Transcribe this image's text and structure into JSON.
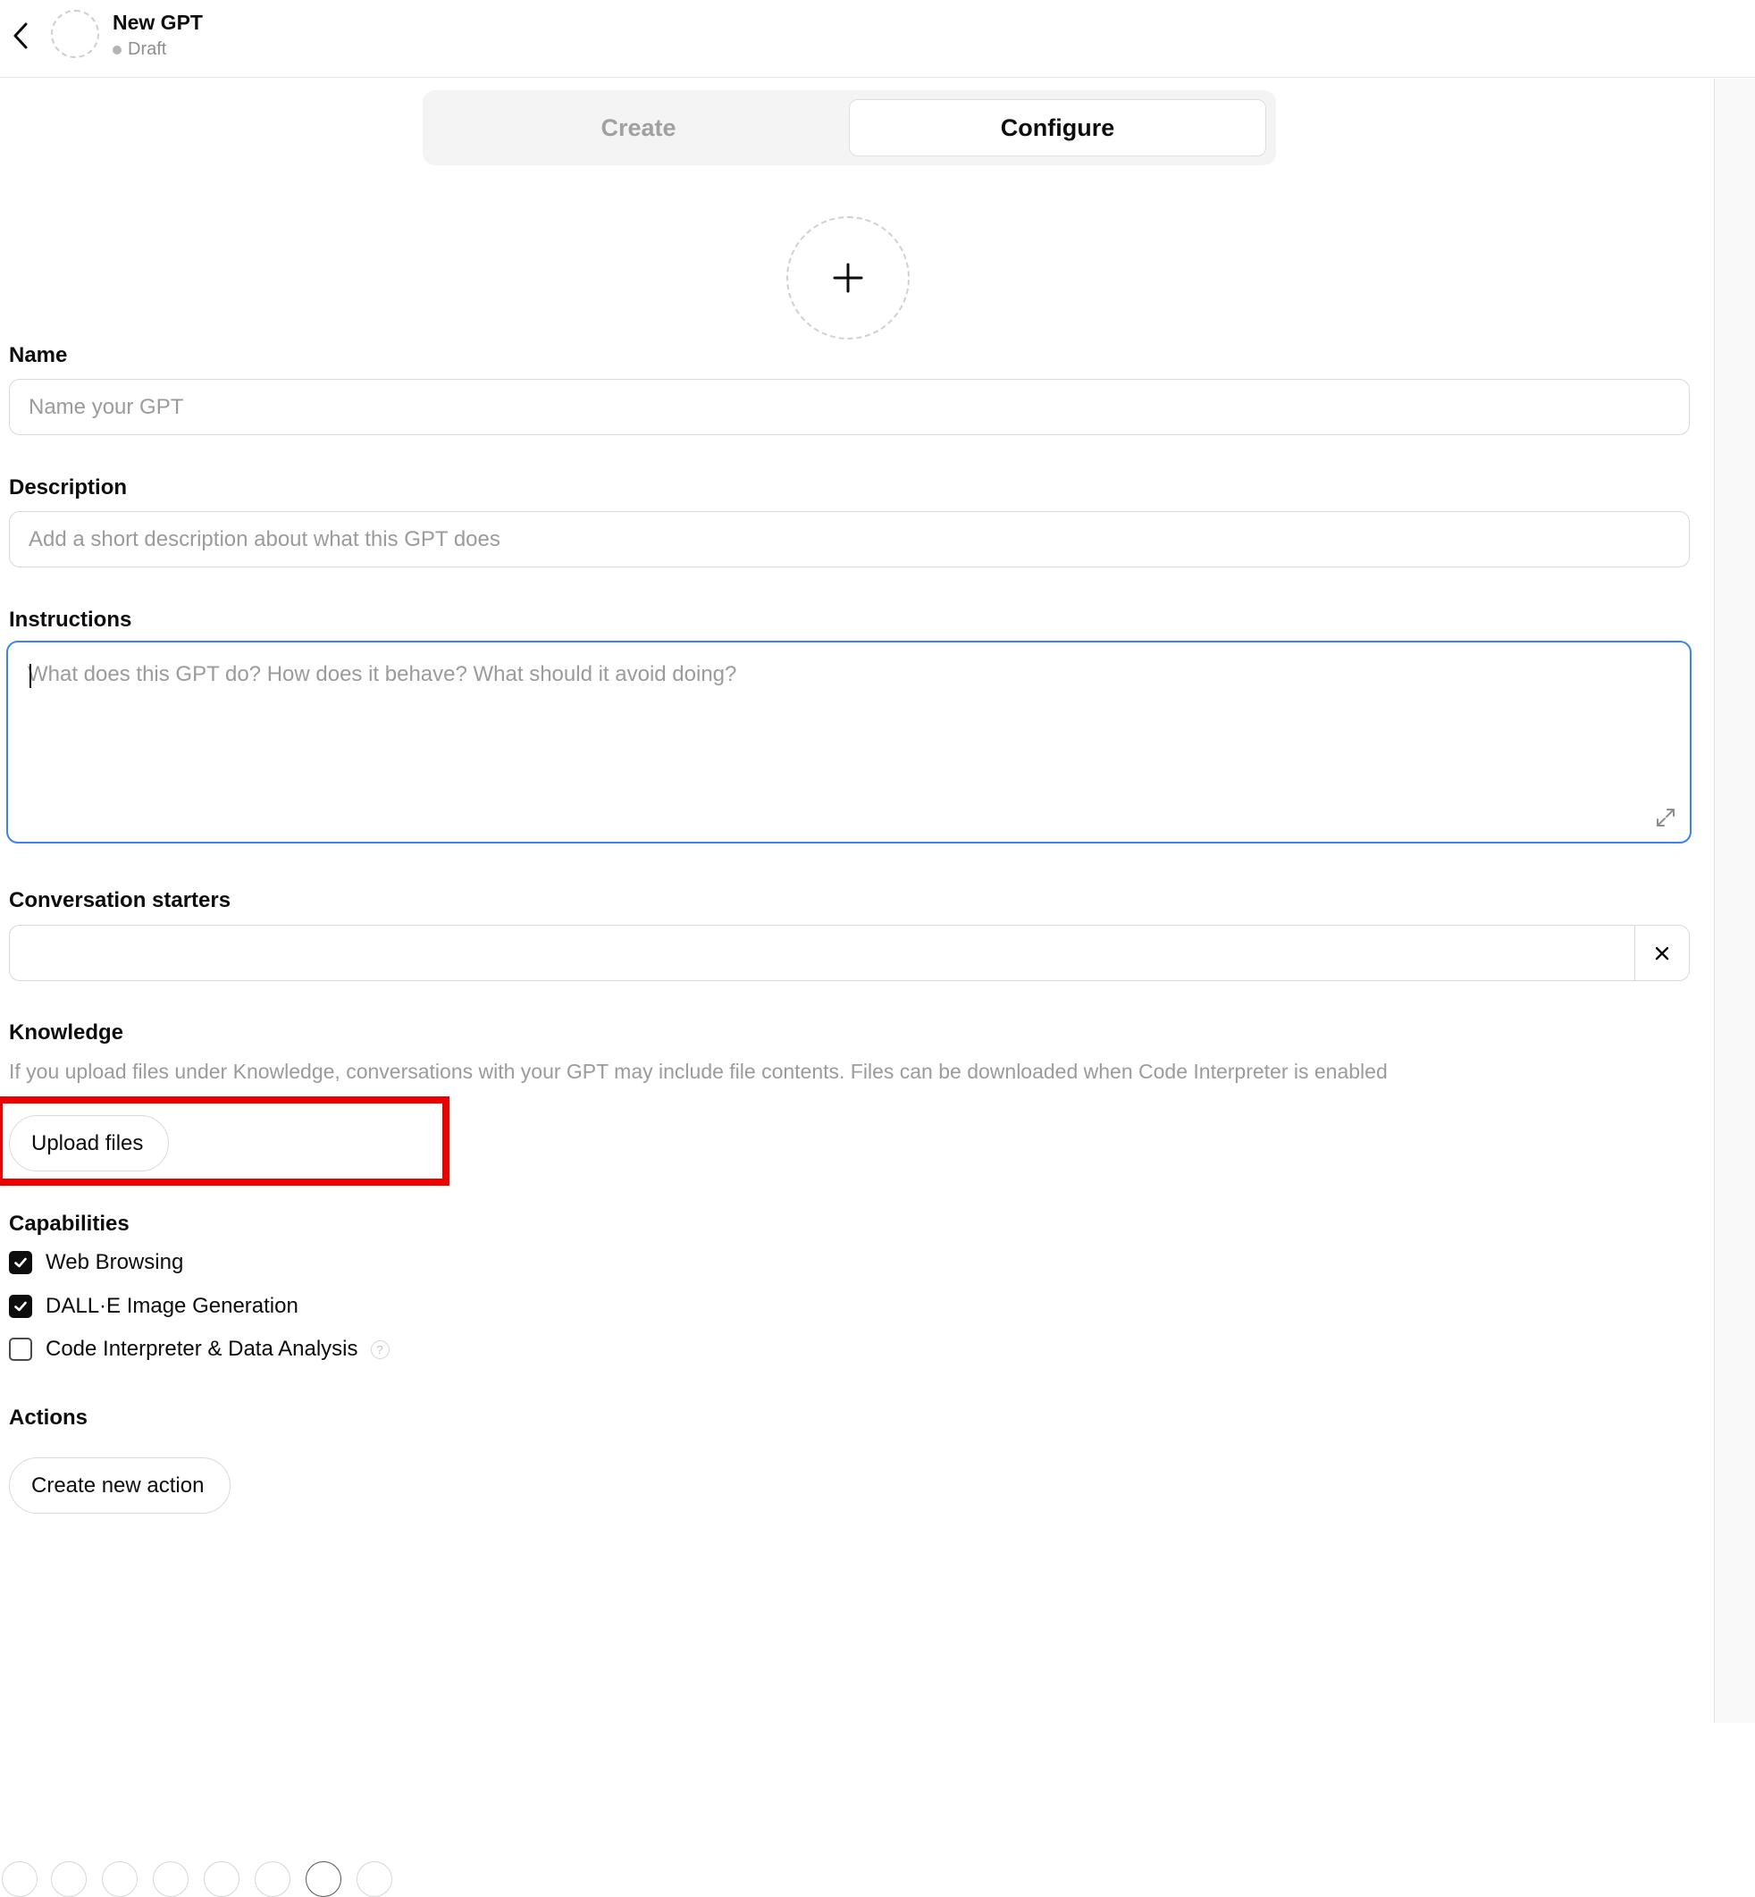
{
  "header": {
    "title": "New GPT",
    "status": "Draft"
  },
  "tabs": [
    {
      "label": "Create",
      "active": false
    },
    {
      "label": "Configure",
      "active": true
    }
  ],
  "form": {
    "name": {
      "label": "Name",
      "placeholder": "Name your GPT",
      "value": ""
    },
    "description": {
      "label": "Description",
      "placeholder": "Add a short description about what this GPT does",
      "value": ""
    },
    "instructions": {
      "label": "Instructions",
      "placeholder": "What does this GPT do? How does it behave? What should it avoid doing?",
      "value": ""
    },
    "conversation_starters": {
      "label": "Conversation starters",
      "value": ""
    }
  },
  "knowledge": {
    "label": "Knowledge",
    "note": "If you upload files under Knowledge, conversations with your GPT may include file contents. Files can be downloaded when Code Interpreter is enabled",
    "upload_label": "Upload files"
  },
  "capabilities": {
    "label": "Capabilities",
    "items": [
      {
        "label": "Web Browsing",
        "checked": true
      },
      {
        "label": "DALL·E Image Generation",
        "checked": true
      },
      {
        "label": "Code Interpreter & Data Analysis",
        "checked": false
      }
    ],
    "help_glyph": "?"
  },
  "actions": {
    "label": "Actions",
    "create_label": "Create new action"
  },
  "colors": {
    "focus_border": "#3b82f6",
    "highlight": "#ee0000"
  }
}
